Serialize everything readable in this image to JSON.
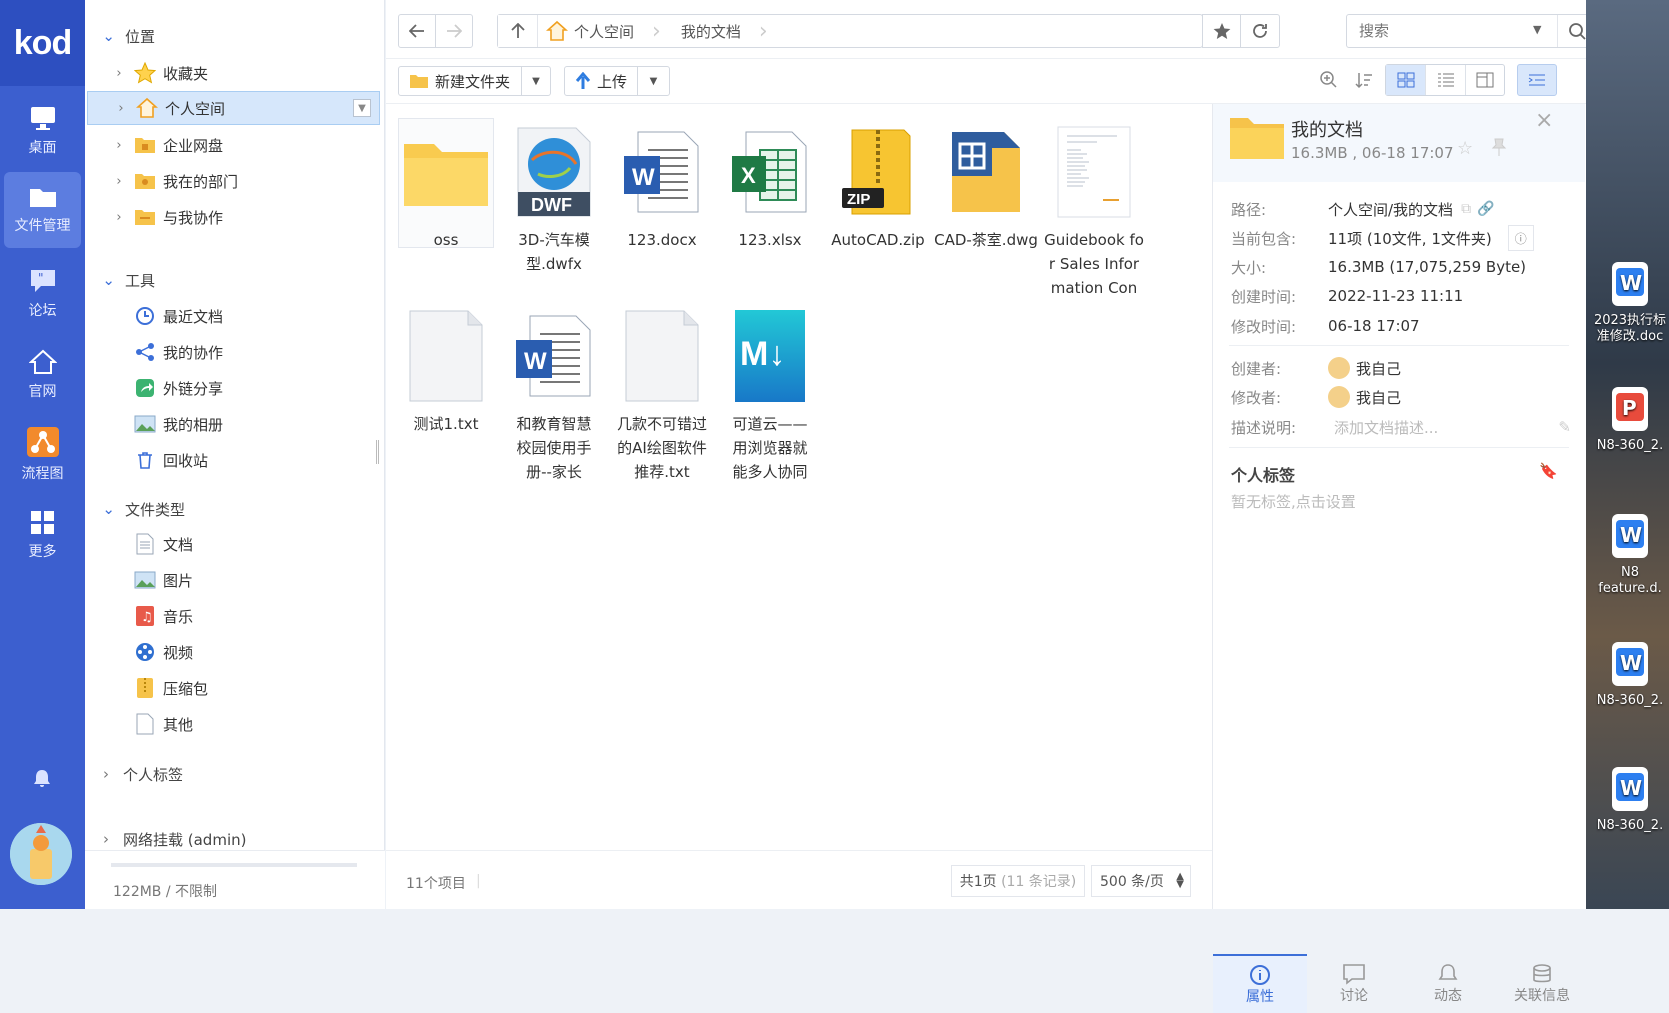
{
  "rail": {
    "logo": "kod",
    "items": [
      "桌面",
      "文件管理",
      "论坛",
      "官网",
      "流程图",
      "更多"
    ]
  },
  "tree": {
    "location_group": "位置",
    "locations": [
      "收藏夹",
      "个人空间",
      "企业网盘",
      "我在的部门",
      "与我协作"
    ],
    "tools_group": "工具",
    "tools": [
      "最近文档",
      "我的协作",
      "外链分享",
      "我的相册",
      "回收站"
    ],
    "types_group": "文件类型",
    "types": [
      "文档",
      "图片",
      "音乐",
      "视频",
      "压缩包",
      "其他"
    ],
    "tags_group": "个人标签",
    "mount_group": "网络挂载 (admin)",
    "quota": "122MB / 不限制"
  },
  "breadcrumb": [
    "个人空间",
    "我的文档"
  ],
  "search": {
    "placeholder": "搜索"
  },
  "toolbar": {
    "new_folder": "新建文件夹",
    "upload": "上传"
  },
  "files": [
    {
      "name": "oss",
      "type": "folder"
    },
    {
      "name": "3D-汽车模型.dwfx",
      "type": "dwf"
    },
    {
      "name": "123.docx",
      "type": "word"
    },
    {
      "name": "123.xlsx",
      "type": "excel"
    },
    {
      "name": "AutoCAD.zip",
      "type": "zip"
    },
    {
      "name": "CAD-茶室.dwg",
      "type": "dwg"
    },
    {
      "name": "Guidebook for Sales Information Con",
      "type": "doc-preview"
    },
    {
      "name": "测试1.txt",
      "type": "txt"
    },
    {
      "name": "和教育智慧校园使用手册--家长",
      "type": "word"
    },
    {
      "name": "几款不可错过的AI绘图软件推荐.txt",
      "type": "txt"
    },
    {
      "name": "可道云——用浏览器就能多人协同",
      "type": "markdown"
    }
  ],
  "status": {
    "count": "11个项目",
    "pages": "共1页",
    "records": "(11 条记录)",
    "per_page": "500 条/页"
  },
  "props": {
    "title": "我的文档",
    "subtitle": "16.3MB , 06-18 17:07",
    "rows": [
      {
        "k": "路径:",
        "v": "个人空间/我的文档"
      },
      {
        "k": "当前包含:",
        "v": "11项 (10文件, 1文件夹)"
      },
      {
        "k": "大小:",
        "v": "16.3MB (17,075,259 Byte)"
      },
      {
        "k": "创建时间:",
        "v": "2022-11-23 11:11"
      },
      {
        "k": "修改时间:",
        "v": "06-18 17:07"
      }
    ],
    "creator_label": "创建者:",
    "creator": "我自己",
    "modifier_label": "修改者:",
    "modifier": "我自己",
    "desc_label": "描述说明:",
    "desc_placeholder": "添加文档描述...",
    "tags_title": "个人标签",
    "tags_empty": "暂无标签,点击设置",
    "tabs": [
      "属性",
      "讨论",
      "动态",
      "关联信息"
    ]
  },
  "desktop": [
    "2023执行标准修改.doc",
    "N8-360_2.",
    "N8 feature.d.",
    "N8-360_2.",
    "N8-360_2."
  ]
}
